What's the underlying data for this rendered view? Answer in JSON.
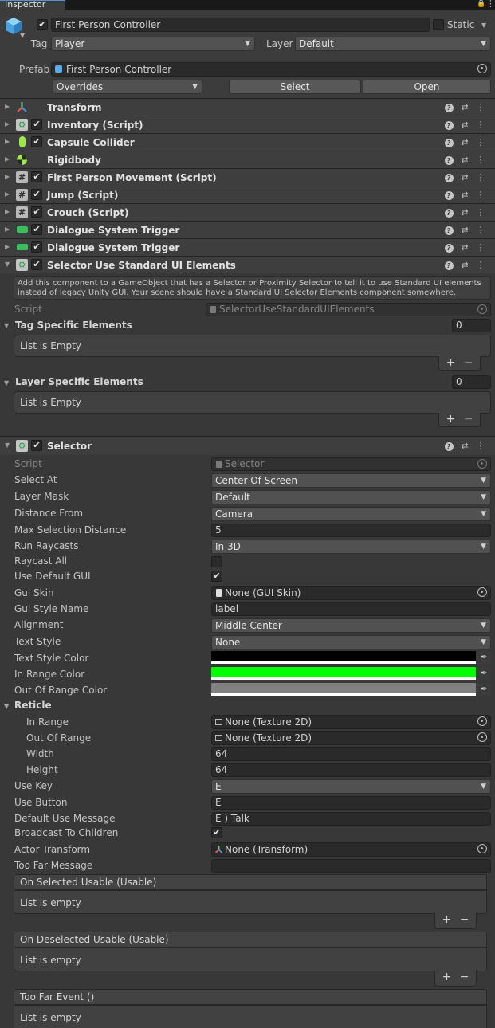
{
  "tab": {
    "title": "Inspector"
  },
  "header": {
    "object_name": "First Person Controller",
    "static_label": "Static",
    "tag_label": "Tag",
    "tag_value": "Player",
    "layer_label": "Layer",
    "layer_value": "Default",
    "prefab_label": "Prefab",
    "prefab_value": "First Person Controller",
    "overrides": "Overrides",
    "select_btn": "Select",
    "open_btn": "Open"
  },
  "components": [
    {
      "name": "Transform"
    },
    {
      "name": "Inventory (Script)"
    },
    {
      "name": "Capsule Collider"
    },
    {
      "name": "Rigidbody"
    },
    {
      "name": "First Person Movement (Script)"
    },
    {
      "name": "Jump (Script)"
    },
    {
      "name": "Crouch (Script)"
    },
    {
      "name": "Dialogue System Trigger"
    },
    {
      "name": "Dialogue System Trigger"
    },
    {
      "name": "Selector Use Standard UI Elements"
    }
  ],
  "standard_ui": {
    "help_text": "Add this component to a GameObject that has a Selector or Proximity Selector to tell it to use Standard UI elements instead of legacy Unity GUI. Your scene should have a Standard UI Selector Elements component somewhere.",
    "script_label": "Script",
    "script_value": "SelectorUseStandardUIElements",
    "tag_list_label": "Tag Specific Elements",
    "tag_list_count": "0",
    "tag_list_empty": "List is Empty",
    "layer_list_label": "Layer Specific Elements",
    "layer_list_count": "0",
    "layer_list_empty": "List is Empty",
    "plus": "+",
    "minus": "−"
  },
  "selector": {
    "name": "Selector",
    "script_label": "Script",
    "script_value": "Selector",
    "select_at_label": "Select At",
    "select_at": "Center Of Screen",
    "layer_mask_label": "Layer Mask",
    "layer_mask": "Default",
    "distance_from_label": "Distance From",
    "distance_from": "Camera",
    "max_dist_label": "Max Selection Distance",
    "max_dist": "5",
    "run_raycasts_label": "Run Raycasts",
    "run_raycasts": "In 3D",
    "raycast_all_label": "Raycast All",
    "use_default_gui_label": "Use Default GUI",
    "gui_skin_label": "Gui Skin",
    "gui_skin": "None (GUI Skin)",
    "gui_style_label": "Gui Style Name",
    "gui_style": "label",
    "alignment_label": "Alignment",
    "alignment": "Middle Center",
    "text_style_label": "Text Style",
    "text_style": "None",
    "text_style_color_label": "Text Style Color",
    "text_style_color": "#000000",
    "in_range_color_label": "In Range Color",
    "in_range_color": "#00ff00",
    "out_range_color_label": "Out Of Range Color",
    "out_range_color": "#808080",
    "reticle_label": "Reticle",
    "in_range_label": "In Range",
    "in_range": "None (Texture 2D)",
    "out_of_range_label": "Out Of Range",
    "out_of_range": "None (Texture 2D)",
    "width_label": "Width",
    "width": "64",
    "height_label": "Height",
    "height": "64",
    "use_key_label": "Use Key",
    "use_key": "E",
    "use_button_label": "Use Button",
    "use_button": "E",
    "default_msg_label": "Default Use Message",
    "default_msg": "E ) Talk",
    "broadcast_label": "Broadcast To Children",
    "actor_transform_label": "Actor Transform",
    "actor_transform": "None (Transform)",
    "too_far_msg_label": "Too Far Message",
    "too_far_msg": "",
    "event1_label": "On Selected Usable (Usable)",
    "event1_empty": "List is empty",
    "event2_label": "On Deselected Usable (Usable)",
    "event2_empty": "List is empty",
    "event3_label": "Too Far Event ()",
    "event3_empty": "List is empty"
  }
}
